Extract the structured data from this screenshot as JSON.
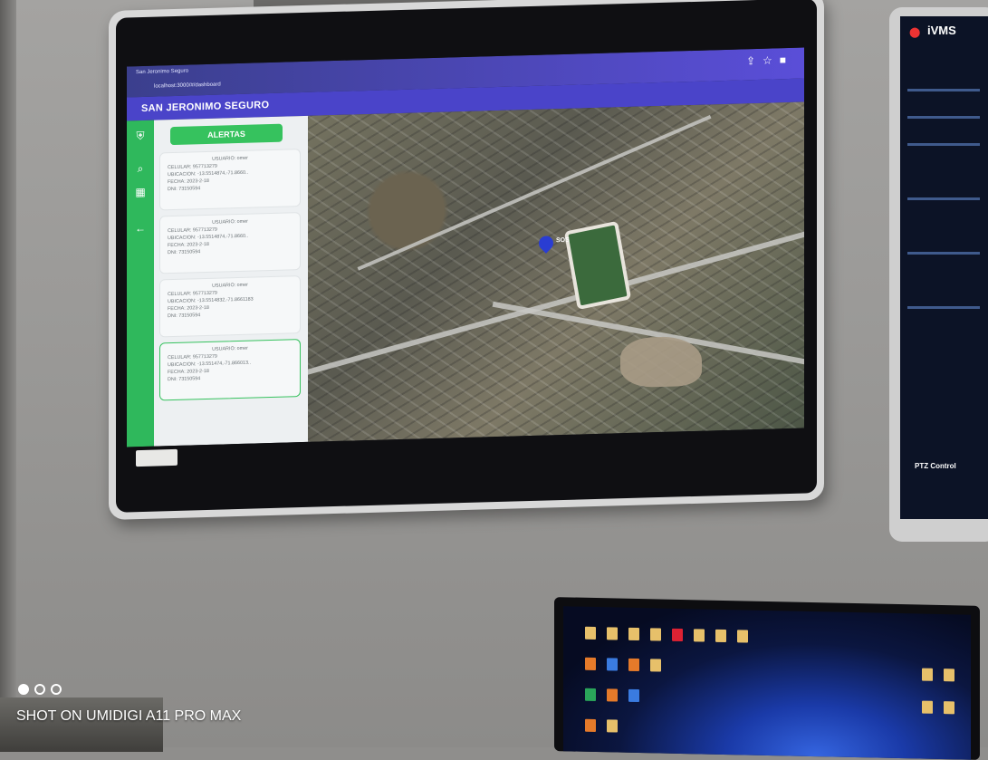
{
  "browser": {
    "tab_title": "San Jeronimo Seguro",
    "address": "localhost:3000/#/dashboard"
  },
  "app": {
    "title": "SAN JERONIMO SEGURO"
  },
  "panel": {
    "header": "ALERTAS",
    "cards": [
      {
        "usuario": "USUARIO: omer",
        "celular": "CELULAR: 957713279",
        "ubicacion": "UBICACION: -13.5514874,-71.8660..",
        "fecha": "FECHA: 2023-2-18",
        "dni": "DNI: 73150594"
      },
      {
        "usuario": "USUARIO: omer",
        "celular": "CELULAR: 957713279",
        "ubicacion": "UBICACION: -13.5514874,-71.8660..",
        "fecha": "FECHA: 2023-2-18",
        "dni": "DNI: 73150594"
      },
      {
        "usuario": "USUARIO: omer",
        "celular": "CELULAR: 957713279",
        "ubicacion": "UBICACION: -13.5514832,-71.8661183",
        "fecha": "FECHA: 2023-2-18",
        "dni": "DNI: 73150594"
      },
      {
        "usuario": "USUARIO: omer",
        "celular": "CELULAR: 957713279",
        "ubicacion": "UBICACION: -13.551474,-71.866013..",
        "fecha": "FECHA: 2023-2-18",
        "dni": "DNI: 73150594"
      }
    ]
  },
  "map": {
    "marker_label": "SOS"
  },
  "right_monitor": {
    "title": "iVMS",
    "bottom_label": "PTZ Control"
  },
  "camera_watermark": "SHOT ON UMIDIGI A11 PRO MAX",
  "colors": {
    "header": "#4a44c9",
    "sidebar": "#2fb85c",
    "alert_header": "#36c25e"
  }
}
